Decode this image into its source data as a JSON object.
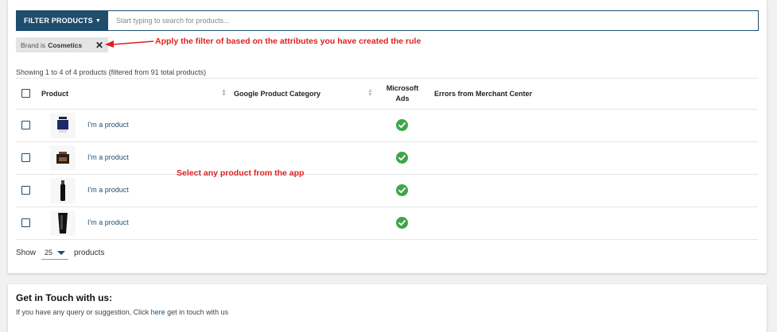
{
  "filter": {
    "button_label": "FILTER PRODUCTS",
    "search_placeholder": "Start typing to search for products...",
    "chip_prefix": "Brand is",
    "chip_value": "Cosmetics",
    "chip_close": "✕"
  },
  "annotations": {
    "filter_note": "Apply the filter of based on the attributes you have created the rule",
    "select_note": "Select any product from the app"
  },
  "table": {
    "showing_text": "Showing 1 to 4 of 4 products (filtered from 91 total products)",
    "headers": {
      "product": "Product",
      "google_category": "Google Product Category",
      "ms_ads_line1": "Microsoft",
      "ms_ads_line2": "Ads",
      "errors": "Errors from Merchant Center"
    },
    "rows": [
      {
        "name": "I'm a product",
        "google_category": "",
        "microsoft_ads": "approved",
        "errors": ""
      },
      {
        "name": "I'm a product",
        "google_category": "",
        "microsoft_ads": "approved",
        "errors": ""
      },
      {
        "name": "I'm a product",
        "google_category": "",
        "microsoft_ads": "approved",
        "errors": ""
      },
      {
        "name": "I'm a product",
        "google_category": "",
        "microsoft_ads": "approved",
        "errors": ""
      }
    ]
  },
  "pagination": {
    "show_label": "Show",
    "page_size": "25",
    "products_label": "products"
  },
  "contact": {
    "title": "Get in Touch with us:",
    "text_before": "If you have any query or suggestion, Click ",
    "link": "here",
    "text_after": " get in touch with us"
  },
  "colors": {
    "primary": "#1f4d6e",
    "annotation": "#e02020",
    "success": "#3ea64b"
  }
}
